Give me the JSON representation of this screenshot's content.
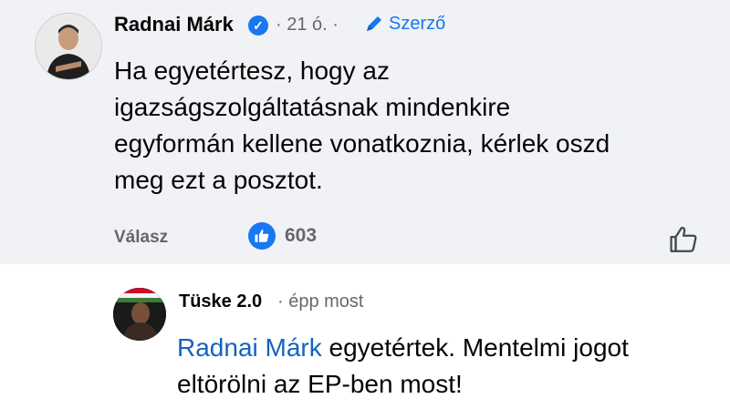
{
  "comment": {
    "author": "Radnai Márk",
    "verified_icon": "verified-badge-icon",
    "time_meta": "· 21 ó. ·",
    "author_badge": "Szerző",
    "text": "Ha egyetértesz, hogy az igazságszolgáltatásnak mindenkire egyformán kellene vonatkoznia, kérlek oszd meg ezt a posztot.",
    "reply_label": "Válasz",
    "reaction_count": "603",
    "colors": {
      "accent": "#1877f2",
      "background": "#f0f2f5"
    }
  },
  "reply": {
    "author": "Tüske 2.0",
    "time_meta": "· épp most",
    "mention": "Radnai Márk",
    "text": " egyetértek. Mentelmi jogot eltörölni az EP-ben most!"
  }
}
